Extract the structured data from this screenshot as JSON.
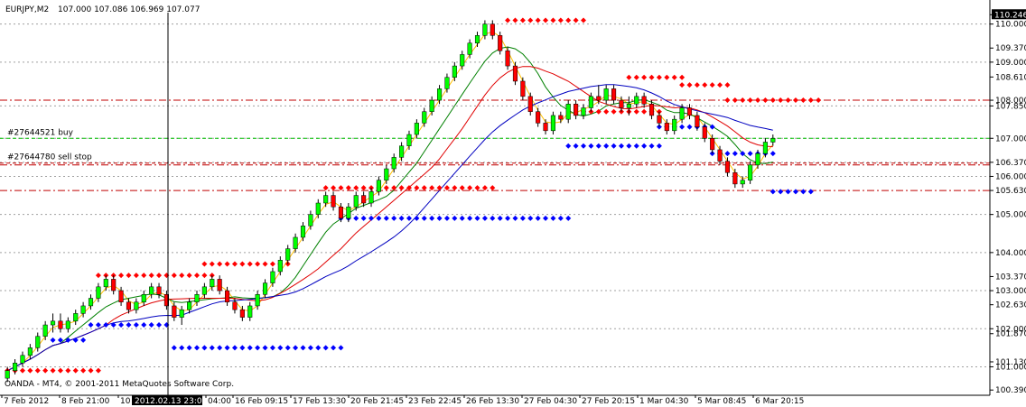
{
  "header": {
    "symbol_label": "EURJPY,M2",
    "ohlc_text": "107.000 107.086 106.969 107.077"
  },
  "orders": [
    {
      "label": "#27644521 buy",
      "price": 107.0,
      "color": "#00c000"
    },
    {
      "label": "#27644780 sell stop",
      "price": 106.35,
      "color": "#c00000"
    }
  ],
  "footer": {
    "copyright": "OANDA - MT4, © 2001-2011 MetaQuotes Software Corp."
  },
  "crosshair": {
    "time_label": "2012.02.13 23:00"
  },
  "colors": {
    "bull": "#00ff00",
    "bear": "#ff0000",
    "sr_red": "#ff0000",
    "sr_blue": "#0000ff",
    "ma_yellow": "#ffc000",
    "ma_red": "#e00000",
    "ma_green": "#008000",
    "ma_blue": "#0000c0",
    "level_red": "#c00000"
  },
  "chart_data": {
    "type": "candlestick",
    "ylim": [
      100.3,
      110.3
    ],
    "y_axis_labels": [
      {
        "text": "110.246",
        "value": 110.246,
        "highlight": true
      },
      {
        "text": "110.000",
        "value": 110.0
      },
      {
        "text": "109.370",
        "value": 109.37
      },
      {
        "text": "109.000",
        "value": 109.0
      },
      {
        "text": "108.610",
        "value": 108.61
      },
      {
        "text": "108.000",
        "value": 108.0
      },
      {
        "text": "107.850",
        "value": 107.85
      },
      {
        "text": "107.000",
        "value": 107.0
      },
      {
        "text": "106.370",
        "value": 106.37
      },
      {
        "text": "106.000",
        "value": 106.0
      },
      {
        "text": "105.630",
        "value": 105.63
      },
      {
        "text": "105.000",
        "value": 105.0
      },
      {
        "text": "104.000",
        "value": 104.0
      },
      {
        "text": "103.370",
        "value": 103.37
      },
      {
        "text": "103.000",
        "value": 103.0
      },
      {
        "text": "102.630",
        "value": 102.63
      },
      {
        "text": "102.000",
        "value": 102.0
      },
      {
        "text": "101.870",
        "value": 101.87
      },
      {
        "text": "101.130",
        "value": 101.13
      },
      {
        "text": "101.000",
        "value": 101.0
      },
      {
        "text": "100.390",
        "value": 100.39
      }
    ],
    "dotted_levels": [
      110.0,
      109.0,
      107.85,
      107.0,
      106.37,
      106.0,
      105.0,
      104.0,
      103.0,
      102.0,
      101.0
    ],
    "red_dashdot_levels": [
      108.0,
      105.63,
      106.3
    ],
    "x_axis_labels": [
      "7 Feb 2012",
      "8 Feb 21:00",
      "10",
      "04:00",
      "16 Feb 09:15",
      "17 Feb 13:30",
      "20 Feb 21:45",
      "23 Feb 22:45",
      "26 Feb 13:30",
      "27 Feb 04:30",
      "27 Feb 20:15",
      "1 Mar 04:30",
      "5 Mar 08:45",
      "6 Mar 20:15"
    ],
    "candles": [
      [
        100.7,
        101.0,
        100.6,
        100.9
      ],
      [
        100.9,
        101.2,
        100.8,
        101.1
      ],
      [
        101.1,
        101.4,
        101.0,
        101.3
      ],
      [
        101.3,
        101.6,
        101.2,
        101.5
      ],
      [
        101.5,
        101.9,
        101.4,
        101.8
      ],
      [
        101.8,
        102.2,
        101.7,
        102.1
      ],
      [
        102.1,
        102.4,
        101.9,
        102.2
      ],
      [
        102.2,
        102.4,
        101.9,
        102.0
      ],
      [
        102.0,
        102.3,
        101.9,
        102.2
      ],
      [
        102.2,
        102.5,
        102.1,
        102.4
      ],
      [
        102.4,
        102.7,
        102.3,
        102.6
      ],
      [
        102.6,
        102.9,
        102.5,
        102.8
      ],
      [
        102.8,
        103.2,
        102.7,
        103.1
      ],
      [
        103.1,
        103.4,
        103.0,
        103.3
      ],
      [
        103.3,
        103.4,
        102.9,
        103.0
      ],
      [
        103.0,
        103.1,
        102.6,
        102.7
      ],
      [
        102.7,
        102.8,
        102.4,
        102.5
      ],
      [
        102.5,
        102.8,
        102.4,
        102.7
      ],
      [
        102.7,
        103.0,
        102.6,
        102.9
      ],
      [
        102.9,
        103.2,
        102.8,
        103.1
      ],
      [
        103.1,
        103.2,
        102.8,
        102.9
      ],
      [
        102.9,
        103.0,
        102.5,
        102.6
      ],
      [
        102.6,
        102.7,
        102.2,
        102.3
      ],
      [
        102.3,
        102.6,
        102.1,
        102.5
      ],
      [
        102.5,
        102.8,
        102.4,
        102.7
      ],
      [
        102.7,
        103.0,
        102.6,
        102.9
      ],
      [
        102.9,
        103.2,
        102.8,
        103.1
      ],
      [
        103.1,
        103.4,
        103.0,
        103.3
      ],
      [
        103.3,
        103.4,
        102.9,
        103.0
      ],
      [
        103.0,
        103.1,
        102.6,
        102.7
      ],
      [
        102.7,
        102.8,
        102.4,
        102.5
      ],
      [
        102.5,
        102.6,
        102.2,
        102.3
      ],
      [
        102.3,
        102.7,
        102.2,
        102.6
      ],
      [
        102.6,
        103.0,
        102.5,
        102.9
      ],
      [
        102.9,
        103.3,
        102.8,
        103.2
      ],
      [
        103.2,
        103.6,
        103.1,
        103.5
      ],
      [
        103.5,
        103.9,
        103.4,
        103.8
      ],
      [
        103.8,
        104.2,
        103.7,
        104.1
      ],
      [
        104.1,
        104.5,
        104.0,
        104.4
      ],
      [
        104.4,
        104.8,
        104.3,
        104.7
      ],
      [
        104.7,
        105.1,
        104.6,
        105.0
      ],
      [
        105.0,
        105.4,
        104.9,
        105.3
      ],
      [
        105.3,
        105.6,
        105.2,
        105.5
      ],
      [
        105.5,
        105.6,
        105.1,
        105.2
      ],
      [
        105.2,
        105.3,
        104.8,
        104.9
      ],
      [
        104.9,
        105.3,
        104.8,
        105.2
      ],
      [
        105.2,
        105.6,
        105.1,
        105.5
      ],
      [
        105.5,
        105.6,
        105.2,
        105.3
      ],
      [
        105.3,
        105.7,
        105.2,
        105.6
      ],
      [
        105.6,
        106.0,
        105.5,
        105.9
      ],
      [
        105.9,
        106.3,
        105.8,
        106.2
      ],
      [
        106.2,
        106.6,
        106.1,
        106.5
      ],
      [
        106.5,
        106.9,
        106.4,
        106.8
      ],
      [
        106.8,
        107.2,
        106.7,
        107.1
      ],
      [
        107.1,
        107.5,
        107.0,
        107.4
      ],
      [
        107.4,
        107.8,
        107.3,
        107.7
      ],
      [
        107.7,
        108.1,
        107.6,
        108.0
      ],
      [
        108.0,
        108.4,
        107.9,
        108.3
      ],
      [
        108.3,
        108.7,
        108.2,
        108.6
      ],
      [
        108.6,
        109.0,
        108.5,
        108.9
      ],
      [
        108.9,
        109.3,
        108.8,
        109.2
      ],
      [
        109.2,
        109.6,
        109.1,
        109.5
      ],
      [
        109.5,
        109.8,
        109.4,
        109.7
      ],
      [
        109.7,
        110.1,
        109.6,
        110.0
      ],
      [
        110.0,
        110.1,
        109.6,
        109.7
      ],
      [
        109.7,
        109.8,
        109.2,
        109.3
      ],
      [
        109.3,
        109.4,
        108.8,
        108.9
      ],
      [
        108.9,
        109.0,
        108.4,
        108.5
      ],
      [
        108.5,
        108.6,
        108.0,
        108.1
      ],
      [
        108.1,
        108.2,
        107.6,
        107.7
      ],
      [
        107.7,
        107.8,
        107.3,
        107.4
      ],
      [
        107.4,
        107.5,
        107.1,
        107.2
      ],
      [
        107.2,
        107.7,
        107.1,
        107.6
      ],
      [
        107.6,
        107.7,
        107.4,
        107.5
      ],
      [
        107.5,
        108.0,
        107.4,
        107.9
      ],
      [
        107.9,
        108.0,
        107.5,
        107.6
      ],
      [
        107.6,
        107.9,
        107.5,
        107.8
      ],
      [
        107.8,
        108.2,
        107.7,
        108.1
      ],
      [
        108.1,
        108.4,
        107.9,
        108.0
      ],
      [
        108.0,
        108.4,
        107.9,
        108.3
      ],
      [
        108.3,
        108.4,
        107.9,
        108.0
      ],
      [
        108.0,
        108.1,
        107.7,
        107.8
      ],
      [
        107.8,
        108.1,
        107.6,
        107.9
      ],
      [
        107.9,
        108.2,
        107.8,
        108.1
      ],
      [
        108.1,
        108.2,
        107.8,
        107.9
      ],
      [
        107.9,
        108.0,
        107.5,
        107.6
      ],
      [
        107.6,
        107.7,
        107.3,
        107.4
      ],
      [
        107.4,
        107.5,
        107.1,
        107.2
      ],
      [
        107.2,
        107.6,
        107.1,
        107.5
      ],
      [
        107.5,
        107.9,
        107.4,
        107.8
      ],
      [
        107.8,
        107.9,
        107.5,
        107.6
      ],
      [
        107.6,
        107.7,
        107.2,
        107.3
      ],
      [
        107.3,
        107.4,
        106.9,
        107.0
      ],
      [
        107.0,
        107.1,
        106.6,
        106.7
      ],
      [
        106.7,
        106.8,
        106.3,
        106.4
      ],
      [
        106.4,
        106.5,
        106.0,
        106.1
      ],
      [
        106.1,
        106.2,
        105.7,
        105.8
      ],
      [
        105.8,
        106.0,
        105.7,
        105.9
      ],
      [
        105.9,
        106.4,
        105.8,
        106.3
      ],
      [
        106.3,
        106.7,
        106.2,
        106.6
      ],
      [
        106.6,
        107.0,
        106.5,
        106.9
      ],
      [
        106.9,
        107.1,
        106.8,
        107.0
      ]
    ],
    "support_resistance": [
      {
        "color": "red",
        "price": 100.9,
        "from": 0,
        "to": 12
      },
      {
        "color": "blue",
        "price": 101.7,
        "from": 6,
        "to": 10
      },
      {
        "color": "red",
        "price": 103.4,
        "from": 12,
        "to": 27
      },
      {
        "color": "blue",
        "price": 102.1,
        "from": 11,
        "to": 21
      },
      {
        "color": "blue",
        "price": 101.5,
        "from": 22,
        "to": 44
      },
      {
        "color": "red",
        "price": 103.7,
        "from": 26,
        "to": 37
      },
      {
        "color": "red",
        "price": 105.7,
        "from": 42,
        "to": 64
      },
      {
        "color": "blue",
        "price": 104.9,
        "from": 44,
        "to": 74
      },
      {
        "color": "red",
        "price": 110.1,
        "from": 66,
        "to": 76
      },
      {
        "color": "red",
        "price": 107.7,
        "from": 76,
        "to": 86
      },
      {
        "color": "blue",
        "price": 106.8,
        "from": 74,
        "to": 86
      },
      {
        "color": "red",
        "price": 108.6,
        "from": 82,
        "to": 89
      },
      {
        "color": "red",
        "price": 108.4,
        "from": 89,
        "to": 95
      },
      {
        "color": "blue",
        "price": 107.3,
        "from": 86,
        "to": 93
      },
      {
        "color": "red",
        "price": 108.0,
        "from": 95,
        "to": 107
      },
      {
        "color": "blue",
        "price": 106.6,
        "from": 93,
        "to": 101
      },
      {
        "color": "blue",
        "price": 105.6,
        "from": 101,
        "to": 106
      }
    ],
    "moving_averages": [
      {
        "color": "yellow",
        "period": 3
      },
      {
        "color": "green",
        "period": 8
      },
      {
        "color": "red",
        "period": 14
      },
      {
        "color": "blue",
        "period": 24
      }
    ],
    "grid": false
  }
}
